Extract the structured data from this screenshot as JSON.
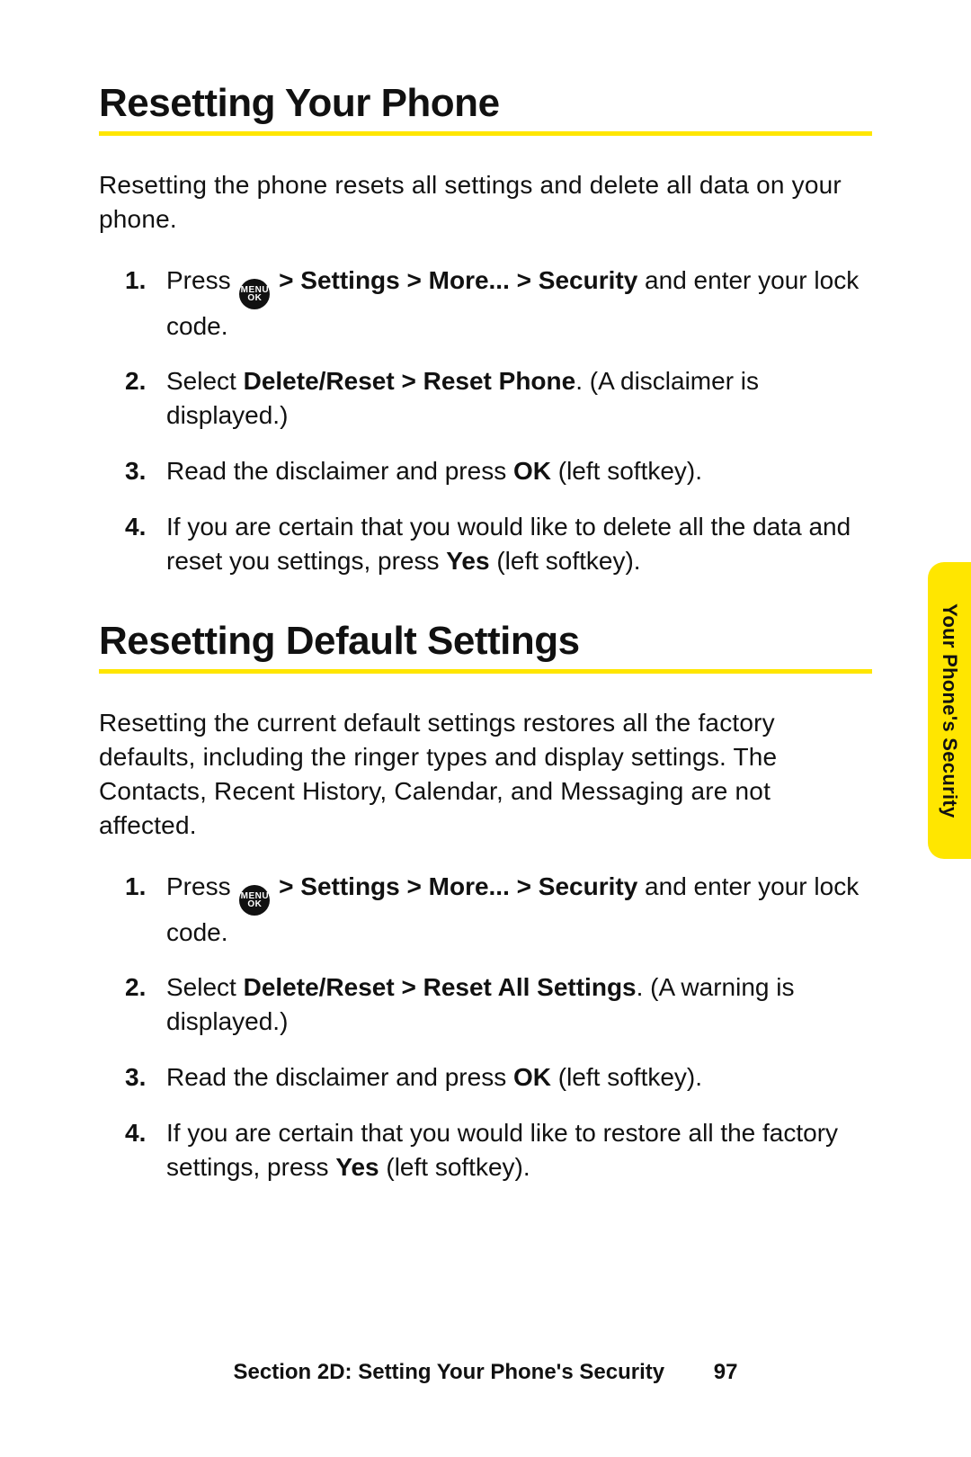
{
  "sideTab": "Your Phone's Security",
  "footer": {
    "section": "Section 2D: Setting Your Phone's Security",
    "page": "97"
  },
  "menuIcon": {
    "top": "MENU",
    "bottom": "OK"
  },
  "section1": {
    "heading": "Resetting Your Phone",
    "intro": "Resetting the phone resets all settings and delete all data on your phone.",
    "steps": [
      {
        "pre": "Press ",
        "bold1": " > Settings > More... > Security",
        "post": " and enter your lock code.",
        "hasIcon": true
      },
      {
        "pre": "Select ",
        "bold1": "Delete/Reset > Reset Phone",
        "post": ". (A disclaimer is displayed.)"
      },
      {
        "pre": "Read the disclaimer and press ",
        "bold1": "OK",
        "post": " (left softkey)."
      },
      {
        "pre": "If you are certain that you would like to delete all the data and reset you settings, press ",
        "bold1": "Yes",
        "post": " (left softkey)."
      }
    ]
  },
  "section2": {
    "heading": "Resetting Default Settings",
    "intro": "Resetting the current default settings restores all the factory defaults, including the ringer types and display settings. The Contacts, Recent History, Calendar, and Messaging are not affected.",
    "steps": [
      {
        "pre": "Press ",
        "bold1": " > Settings > More... > Security",
        "post": " and enter your lock code.",
        "hasIcon": true
      },
      {
        "pre": "Select ",
        "bold1": "Delete/Reset > Reset All Settings",
        "post": ". (A warning is displayed.)"
      },
      {
        "pre": "Read the disclaimer and press ",
        "bold1": "OK",
        "post": " (left softkey)."
      },
      {
        "pre": "If you are certain that you would like to restore all the factory settings, press ",
        "bold1": "Yes",
        "post": " (left softkey)."
      }
    ]
  }
}
